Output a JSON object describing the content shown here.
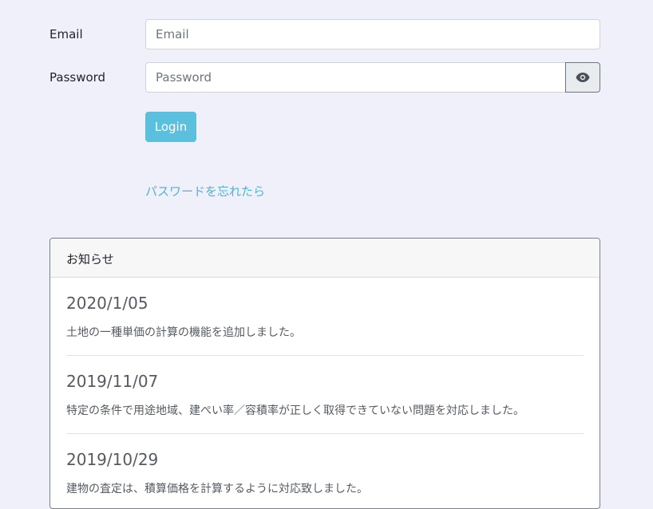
{
  "form": {
    "email_label": "Email",
    "email_placeholder": "Email",
    "email_value": "",
    "password_label": "Password",
    "password_placeholder": "Password",
    "password_value": "",
    "toggle_icon": "eye-icon",
    "login_label": "Login",
    "forgot_link": "パスワードを忘れたら"
  },
  "notices": {
    "title": "お知らせ",
    "items": [
      {
        "date": "2020/1/05",
        "text": "土地の一種単価の計算の機能を追加しました。"
      },
      {
        "date": "2019/11/07",
        "text": "特定の条件で用途地域、建ぺい率／容積率が正しく取得できていない問題を対応しました。"
      },
      {
        "date": "2019/10/29",
        "text": "建物の査定は、積算価格を計算するように対応致しました。"
      }
    ]
  },
  "colors": {
    "background": "#f0f0fb",
    "accent": "#5bc0de",
    "link": "#4fb4cf"
  }
}
